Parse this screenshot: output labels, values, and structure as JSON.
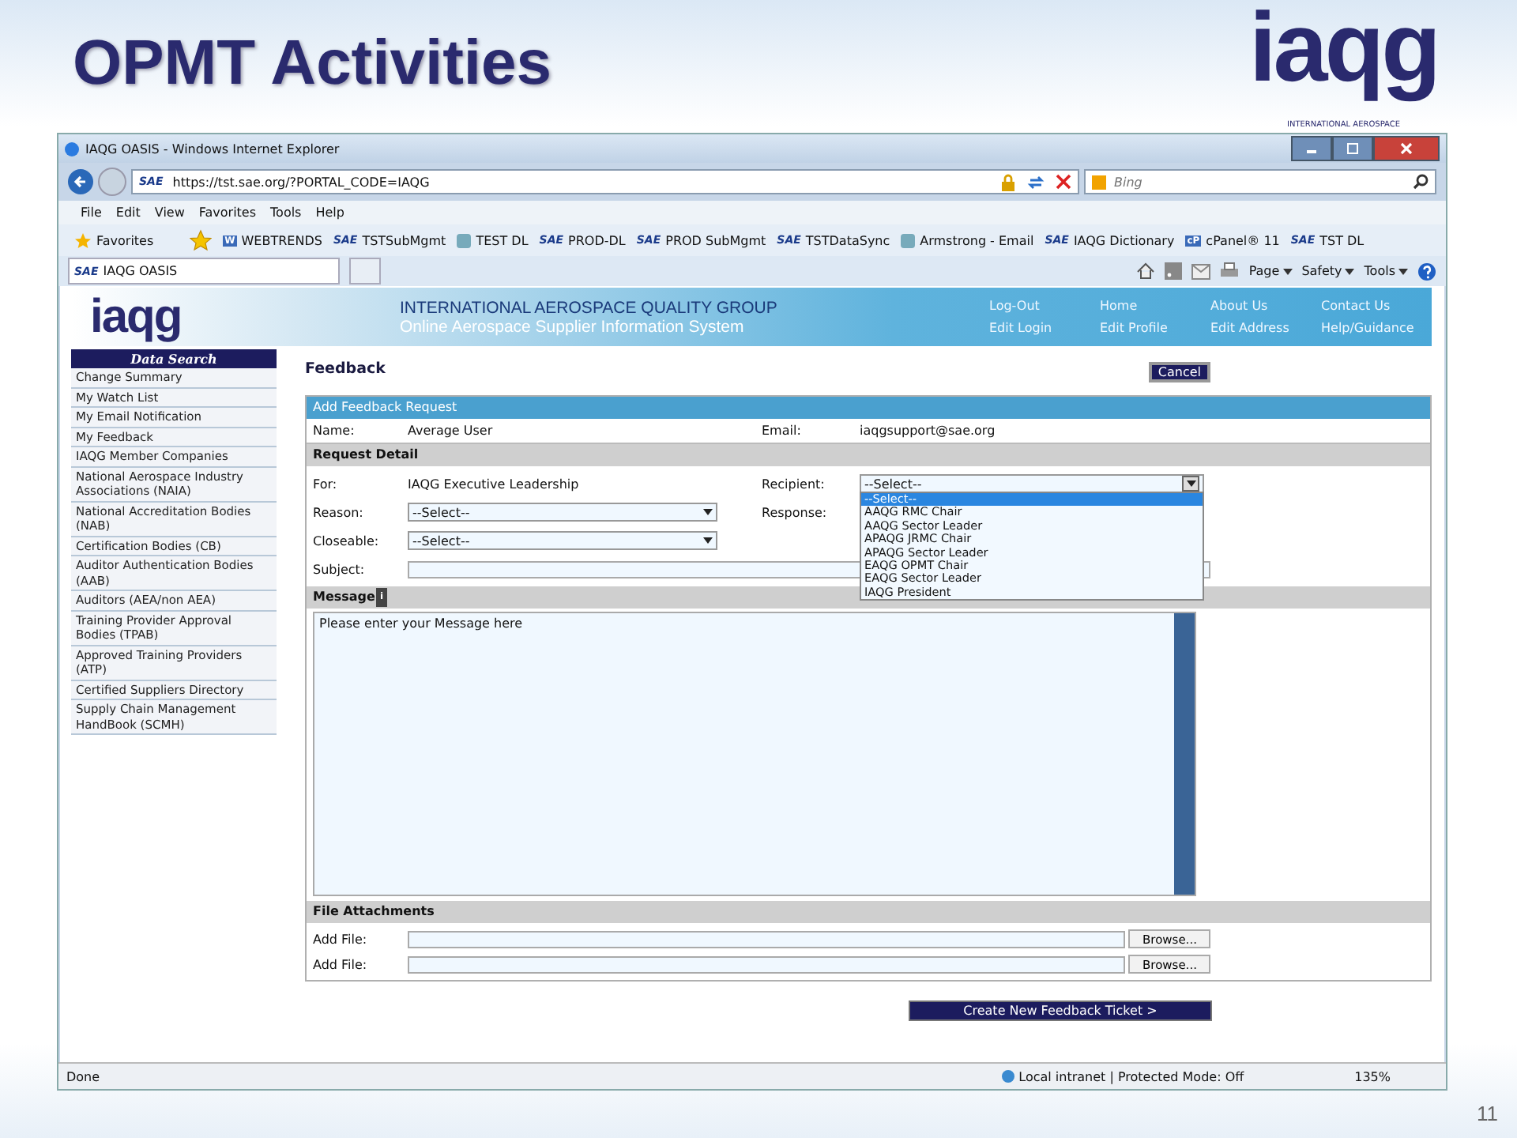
{
  "slide": {
    "title": "OPMT Activities",
    "logo": {
      "text": "iaqg",
      "caption": "INTERNATIONAL AEROSPACE"
    },
    "page_number": "11"
  },
  "browser": {
    "title": "IAQG OASIS - Windows Internet Explorer",
    "address": {
      "badge": "SAE",
      "url": "https://tst.sae.org/?PORTAL_CODE=IAQG"
    },
    "search": {
      "placeholder": "Bing"
    },
    "menu": [
      "File",
      "Edit",
      "View",
      "Favorites",
      "Tools",
      "Help"
    ],
    "favorites_button": "Favorites",
    "favorites": [
      {
        "kind": "badge",
        "badge": "W",
        "label": "WEBTRENDS"
      },
      {
        "kind": "badge",
        "badge": "SAE",
        "label": "TSTSubMgmt"
      },
      {
        "kind": "icon",
        "label": "TEST DL"
      },
      {
        "kind": "badge",
        "badge": "SAE",
        "label": "PROD-DL"
      },
      {
        "kind": "badge",
        "badge": "SAE",
        "label": "PROD SubMgmt"
      },
      {
        "kind": "badge",
        "badge": "SAE",
        "label": "TSTDataSync"
      },
      {
        "kind": "icon",
        "label": "Armstrong - Email"
      },
      {
        "kind": "badge",
        "badge": "SAE",
        "label": "IAQG Dictionary"
      },
      {
        "kind": "badge",
        "badge": "cP",
        "label": "cPanel® 11"
      },
      {
        "kind": "badge",
        "badge": "SAE",
        "label": "TST DL"
      }
    ],
    "tab": {
      "badge": "SAE",
      "label": "IAQG OASIS"
    },
    "tools": [
      "Page",
      "Safety",
      "Tools"
    ],
    "status": {
      "text": "Done",
      "zone": "Local intranet | Protected Mode: Off",
      "zoom": "135%"
    }
  },
  "site": {
    "logo": "iaqg",
    "title": "INTERNATIONAL AEROSPACE QUALITY GROUP",
    "subtitle": "Online Aerospace Supplier Information System",
    "nav": [
      "Log-Out",
      "Home",
      "About Us",
      "Contact Us",
      "Edit Login",
      "Edit Profile",
      "Edit Address",
      "Help/Guidance"
    ],
    "sidebar": {
      "header": "Data Search",
      "items": [
        "Change Summary",
        "My Watch List",
        "My Email Notification",
        "My Feedback",
        "IAQG Member Companies",
        "National Aerospace Industry Associations (NAIA)",
        "National Accreditation Bodies (NAB)",
        "Certification Bodies (CB)",
        "Auditor Authentication Bodies (AAB)",
        "Auditors (AEA/non AEA)",
        "Training Provider Approval Bodies (TPAB)",
        "Approved Training Providers (ATP)",
        "Certified Suppliers Directory",
        "Supply Chain Management HandBook (SCMH)"
      ]
    }
  },
  "form": {
    "heading": "Feedback",
    "cancel": "Cancel",
    "title": "Add Feedback Request",
    "name_label": "Name:",
    "name": "Average User",
    "email_label": "Email:",
    "email": "iaqgsupport@sae.org",
    "detail_header": "Request Detail",
    "for_label": "For:",
    "for": "IAQG Executive Leadership",
    "recipient_label": "Recipient:",
    "recipient_value": "--Select--",
    "recipient_options": [
      {
        "label": "--Select--",
        "selected": true
      },
      {
        "label": "AAQG RMC Chair",
        "selected": false
      },
      {
        "label": "AAQG Sector Leader",
        "selected": false
      },
      {
        "label": "APAQG JRMC Chair",
        "selected": false
      },
      {
        "label": "APAQG Sector Leader",
        "selected": false
      },
      {
        "label": "EAQG OPMT Chair",
        "selected": false
      },
      {
        "label": "EAQG Sector Leader",
        "selected": false
      },
      {
        "label": "IAQG President",
        "selected": false
      }
    ],
    "reason_label": "Reason:",
    "reason_value": "--Select--",
    "response_label": "Response:",
    "closeable_label": "Closeable:",
    "closeable_value": "--Select--",
    "subject_label": "Subject:",
    "message_header": "Message",
    "message_info": "i",
    "message_placeholder": "Please enter your Message here",
    "attachments_header": "File Attachments",
    "files": [
      {
        "label": "Add File:",
        "button": "Browse..."
      },
      {
        "label": "Add File:",
        "button": "Browse..."
      }
    ],
    "submit": "Create New Feedback Ticket >"
  }
}
